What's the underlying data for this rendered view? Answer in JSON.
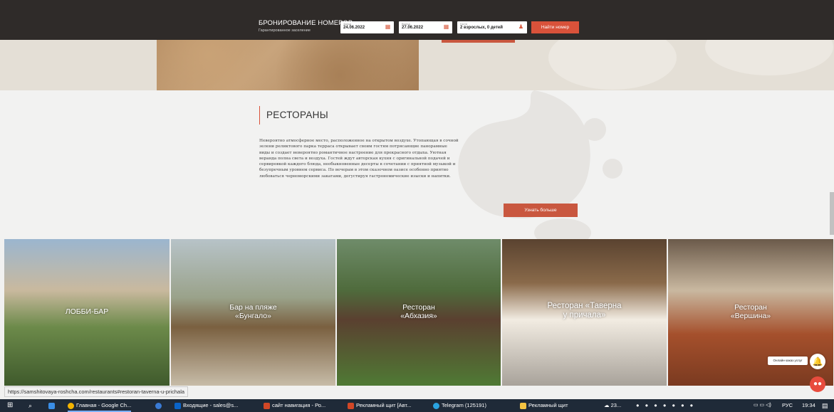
{
  "booking": {
    "title": "БРОНИРОВАНИЕ НОМЕРОВ",
    "subtitle": "Гарантированное заселение",
    "checkin_label": "Заезд",
    "checkin_value": "24.06.2022",
    "checkout_label": "Выезд",
    "checkout_value": "27.06.2022",
    "guests_label": "Гости",
    "guests_value": "2 взрослых, 0 детей",
    "find_button": "Найти номер"
  },
  "restaurants": {
    "heading": "РЕСТОРАНЫ",
    "description": "Невероятно атмосферное место, расположенное на открытом воздухе. Утопающая в сочной зелени реликтового парка терраса открывает своим гостям потрясающие панорамные виды и создает невероятно романтичное настроение для прекрасного отдыха. Уютная веранда полна света и воздуха. Гостей ждут авторская кухня с оригинальной подачей и сервировкой каждого блюда, необыкновенные десерты в сочетании с приятной музыкой и безупречным уровнем сервиса. По вечерам в этом сказочном оазисе особенно приятно любоваться черноморскими закатами, дегустируя гастрономические изыски и напитки.",
    "more_button": "Узнать больше",
    "cards": [
      {
        "name": "ЛОББИ-БАР"
      },
      {
        "line1": "Бар на пляже",
        "line2": "«Бунгало»"
      },
      {
        "line1": "Ресторан",
        "line2": "«Абхазия»"
      },
      {
        "line1": "Ресторан «Таверна",
        "line2": "у причала»"
      },
      {
        "line1": "Ресторан",
        "line2": "«Вершина»"
      }
    ]
  },
  "widgets": {
    "chat_label": "Онлайн-заказ услуг"
  },
  "status_url": "https://samshitovaya-roshcha.com/restaurants#restoran-taverna-u-prichala",
  "taskbar": {
    "items": [
      {
        "label": "Главная - Google Ch...",
        "color": "#f4b400"
      },
      {
        "label": "Входящие - sales@s...",
        "color": "#0a64c8"
      },
      {
        "label": "сайт навигация - Ро...",
        "color": "#d24726"
      },
      {
        "label": "Рекламный щит [Авт...",
        "color": "#d24726"
      },
      {
        "label": "Telegram (125191)",
        "color": "#2aa3e0"
      },
      {
        "label": "Рекламный щит",
        "color": "#f5c342"
      }
    ],
    "weather": "23...",
    "lang": "РУС",
    "time": "19:34"
  },
  "colors": {
    "accent": "#d9523a",
    "header_bg": "#2f2b29"
  }
}
